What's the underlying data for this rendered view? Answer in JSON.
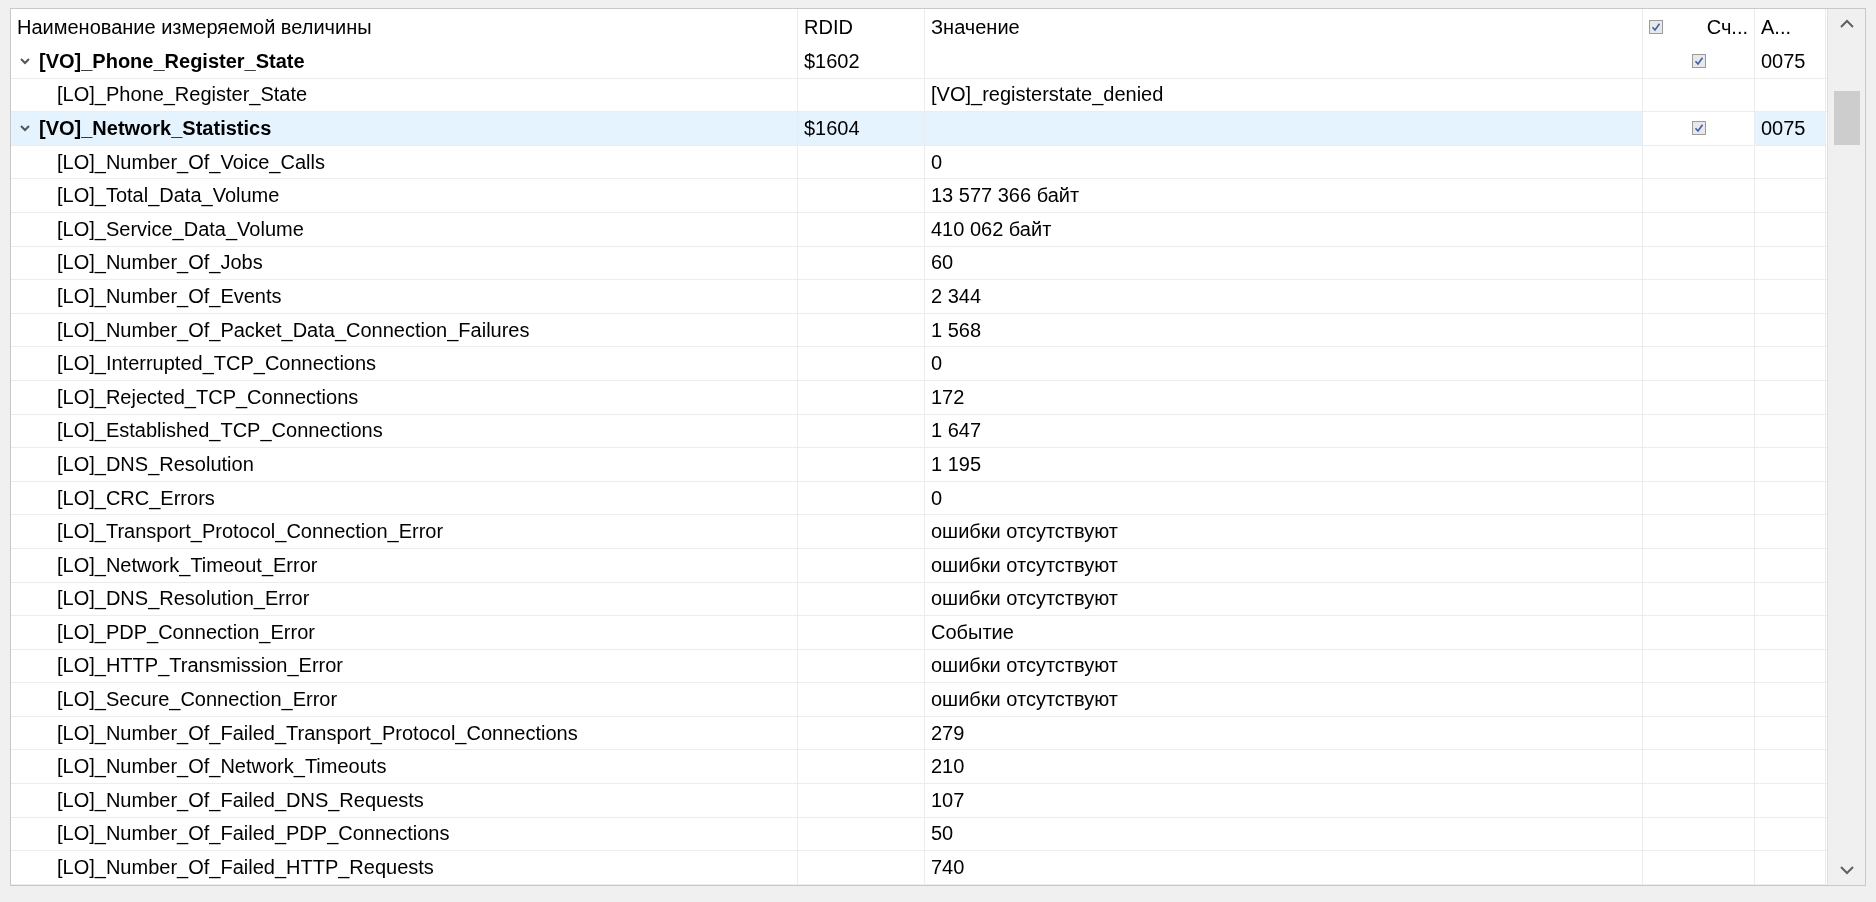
{
  "columns": [
    {
      "label": "Наименование измеряемой величины"
    },
    {
      "label": "RDID"
    },
    {
      "label": "Значение"
    },
    {
      "label": "Сч...",
      "checked": true
    },
    {
      "label": "А..."
    }
  ],
  "rows": [
    {
      "name": "[VO]_Phone_Register_State",
      "rdid": "$1602",
      "checked": true,
      "code": "0075",
      "expanded": true,
      "selected": false,
      "children": [
        {
          "name": "[LO]_Phone_Register_State",
          "value": "[VO]_registerstate_denied",
          "selected": false
        }
      ]
    },
    {
      "name": "[VO]_Network_Statistics",
      "rdid": "$1604",
      "checked": true,
      "code": "0075",
      "expanded": true,
      "selected": true,
      "children": [
        {
          "name": "[LO]_Number_Of_Voice_Calls",
          "value": "0",
          "selected": false
        },
        {
          "name": "[LO]_Total_Data_Volume",
          "value": "13 577 366 байт",
          "selected": false
        },
        {
          "name": "[LO]_Service_Data_Volume",
          "value": "410 062 байт",
          "selected": false
        },
        {
          "name": "[LO]_Number_Of_Jobs",
          "value": "60",
          "selected": false
        },
        {
          "name": "[LO]_Number_Of_Events",
          "value": "2 344",
          "selected": false
        },
        {
          "name": "[LO]_Number_Of_Packet_Data_Connection_Failures",
          "value": "1 568",
          "selected": false
        },
        {
          "name": "[LO]_Interrupted_TCP_Connections",
          "value": "0",
          "selected": false
        },
        {
          "name": "[LO]_Rejected_TCP_Connections",
          "value": "172",
          "selected": false
        },
        {
          "name": "[LO]_Established_TCP_Connections",
          "value": "1 647",
          "selected": false
        },
        {
          "name": "[LO]_DNS_Resolution",
          "value": "1 195",
          "selected": false
        },
        {
          "name": "[LO]_CRC_Errors",
          "value": "0",
          "selected": false
        },
        {
          "name": "[LO]_Transport_Protocol_Connection_Error",
          "value": "ошибки отсутствуют",
          "selected": false
        },
        {
          "name": "[LO]_Network_Timeout_Error",
          "value": "ошибки отсутствуют",
          "selected": false
        },
        {
          "name": "[LO]_DNS_Resolution_Error",
          "value": "ошибки отсутствуют",
          "selected": false
        },
        {
          "name": "[LO]_PDP_Connection_Error",
          "value": "Событие",
          "selected": false
        },
        {
          "name": "[LO]_HTTP_Transmission_Error",
          "value": "ошибки отсутствуют",
          "selected": false
        },
        {
          "name": "[LO]_Secure_Connection_Error",
          "value": "ошибки отсутствуют",
          "selected": false
        },
        {
          "name": "[LO]_Number_Of_Failed_Transport_Protocol_Connections",
          "value": "279",
          "selected": false
        },
        {
          "name": "[LO]_Number_Of_Network_Timeouts",
          "value": "210",
          "selected": false
        },
        {
          "name": "[LO]_Number_Of_Failed_DNS_Requests",
          "value": "107",
          "selected": false
        },
        {
          "name": "[LO]_Number_Of_Failed_PDP_Connections",
          "value": "50",
          "selected": false
        },
        {
          "name": "[LO]_Number_Of_Failed_HTTP_Requests",
          "value": "740",
          "selected": false
        }
      ]
    }
  ]
}
